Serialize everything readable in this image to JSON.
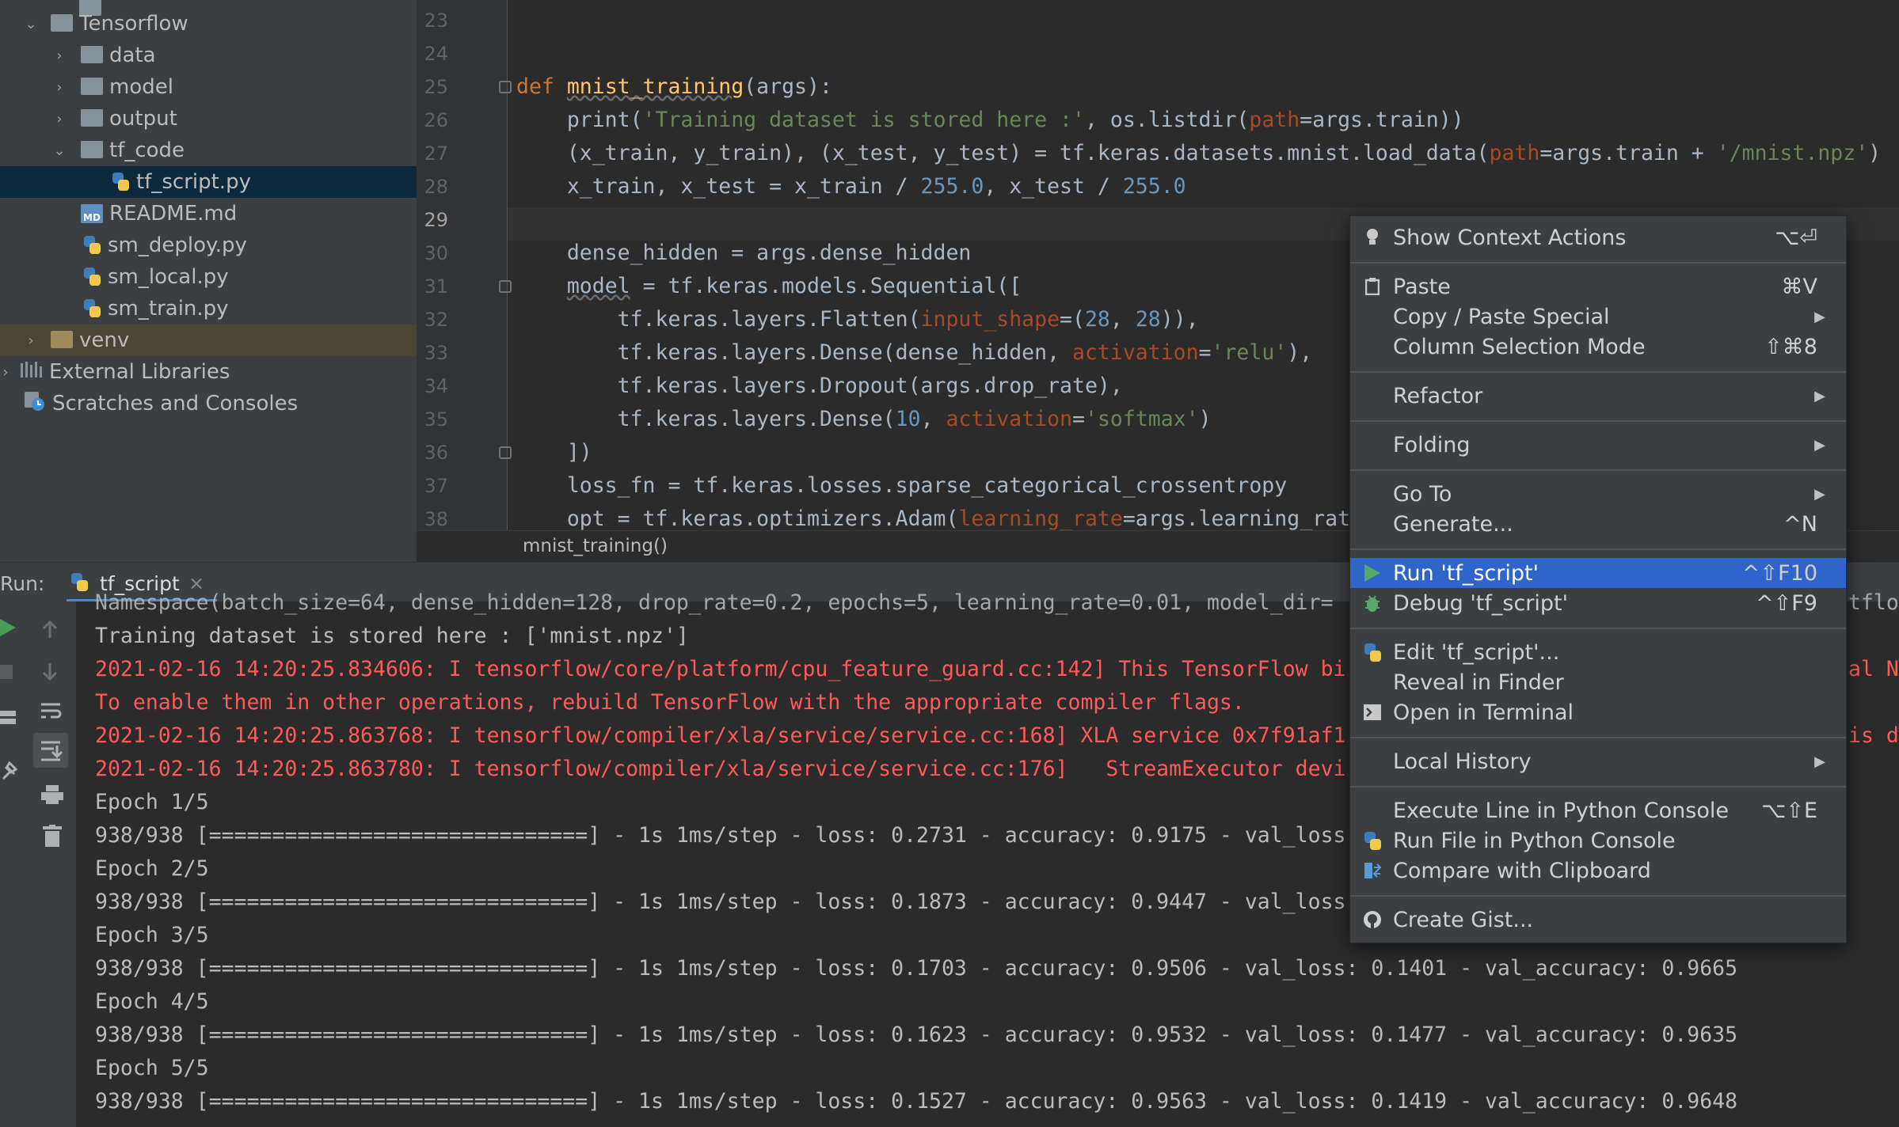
{
  "project": {
    "items": [
      {
        "label": "Tensorflow",
        "type": "folder",
        "expanded": true
      },
      {
        "label": "data",
        "type": "folder"
      },
      {
        "label": "model",
        "type": "folder"
      },
      {
        "label": "output",
        "type": "folder"
      },
      {
        "label": "tf_code",
        "type": "folder",
        "expanded": true
      },
      {
        "label": "tf_script.py",
        "type": "python",
        "selected": true
      },
      {
        "label": "README.md",
        "type": "markdown"
      },
      {
        "label": "sm_deploy.py",
        "type": "python"
      },
      {
        "label": "sm_local.py",
        "type": "python"
      },
      {
        "label": "sm_train.py",
        "type": "python"
      },
      {
        "label": "venv",
        "type": "folder"
      },
      {
        "label": "External Libraries",
        "type": "libraries"
      },
      {
        "label": "Scratches and Consoles",
        "type": "scratches"
      }
    ]
  },
  "editor": {
    "line_numbers": [
      "23",
      "24",
      "25",
      "26",
      "27",
      "28",
      "29",
      "30",
      "31",
      "32",
      "33",
      "34",
      "35",
      "36",
      "37",
      "38"
    ],
    "current_line": "29",
    "breadcrumb": "mnist_training()"
  },
  "run": {
    "label": "Run:",
    "tab": "tf_script",
    "close": "×",
    "console": [
      {
        "text": "Namespace(batch_size=64, dense_hidden=128, drop_rate=0.2, epochs=5, learning_rate=0.01, model_dir=",
        "type": "out"
      },
      {
        "text": "Training dataset is stored here : ['mnist.npz']",
        "type": "out"
      },
      {
        "text": "2021-02-16 14:20:25.834606: I tensorflow/core/platform/cpu_feature_guard.cc:142] This TensorFlow bi",
        "type": "err"
      },
      {
        "text": "To enable them in other operations, rebuild TensorFlow with the appropriate compiler flags.",
        "type": "err"
      },
      {
        "text": "2021-02-16 14:20:25.863768: I tensorflow/compiler/xla/service/service.cc:168] XLA service 0x7f91af1",
        "type": "err"
      },
      {
        "text": "2021-02-16 14:20:25.863780: I tensorflow/compiler/xla/service/service.cc:176]   StreamExecutor devi",
        "type": "err"
      },
      {
        "text": "Epoch 1/5",
        "type": "out"
      },
      {
        "text": "938/938 [==============================] - 1s 1ms/step - loss: 0.2731 - accuracy: 0.9175 - val_loss",
        "type": "out"
      },
      {
        "text": "Epoch 2/5",
        "type": "out"
      },
      {
        "text": "938/938 [==============================] - 1s 1ms/step - loss: 0.1873 - accuracy: 0.9447 - val_loss",
        "type": "out"
      },
      {
        "text": "Epoch 3/5",
        "type": "out"
      },
      {
        "text": "938/938 [==============================] - 1s 1ms/step - loss: 0.1703 - accuracy: 0.9506 - val_loss: 0.1401 - val_accuracy: 0.9665",
        "type": "out"
      },
      {
        "text": "Epoch 4/5",
        "type": "out"
      },
      {
        "text": "938/938 [==============================] - 1s 1ms/step - loss: 0.1623 - accuracy: 0.9532 - val_loss: 0.1477 - val_accuracy: 0.9635",
        "type": "out"
      },
      {
        "text": "Epoch 5/5",
        "type": "out"
      },
      {
        "text": "938/938 [==============================] - 1s 1ms/step - loss: 0.1527 - accuracy: 0.9563 - val_loss: 0.1419 - val_accuracy: 0.9648",
        "type": "out"
      }
    ],
    "right_overflow": [
      {
        "text": "tflow"
      },
      {
        "text": "al Ne"
      },
      {
        "text": "is de"
      }
    ]
  },
  "context_menu": {
    "items": [
      {
        "label": "Show Context Actions",
        "shortcut": "⌥⏎",
        "icon": "bulb-icon"
      },
      {
        "label": "Paste",
        "shortcut": "⌘V",
        "icon": "clipboard-icon"
      },
      {
        "label": "Copy / Paste Special",
        "submenu": true
      },
      {
        "label": "Column Selection Mode",
        "shortcut": "⇧⌘8"
      },
      {
        "label": "Refactor",
        "submenu": true
      },
      {
        "label": "Folding",
        "submenu": true
      },
      {
        "label": "Go To",
        "submenu": true
      },
      {
        "label": "Generate...",
        "shortcut": "^N"
      },
      {
        "label": "Run 'tf_script'",
        "shortcut": "^⇧F10",
        "icon": "run-icon",
        "highlighted": true
      },
      {
        "label": "Debug 'tf_script'",
        "shortcut": "^⇧F9",
        "icon": "debug-icon"
      },
      {
        "label": "Edit 'tf_script'...",
        "icon": "python-icon"
      },
      {
        "label": "Reveal in Finder"
      },
      {
        "label": "Open in Terminal",
        "icon": "terminal-icon"
      },
      {
        "label": "Local History",
        "submenu": true
      },
      {
        "label": "Execute Line in Python Console",
        "shortcut": "⌥⇧E"
      },
      {
        "label": "Run File in Python Console",
        "icon": "python-icon"
      },
      {
        "label": "Compare with Clipboard",
        "icon": "compare-icon"
      },
      {
        "label": "Create Gist...",
        "icon": "github-icon"
      }
    ]
  }
}
